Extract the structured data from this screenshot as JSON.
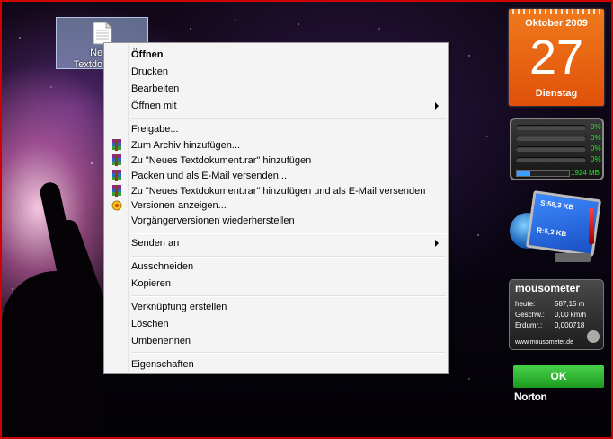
{
  "desktop": {
    "icon_label": "Neues Textdokument"
  },
  "context_menu": {
    "items": [
      {
        "label": "Öffnen",
        "bold": true,
        "submenu": false,
        "icon": null
      },
      {
        "label": "Drucken",
        "submenu": false,
        "icon": null
      },
      {
        "label": "Bearbeiten",
        "submenu": false,
        "icon": null
      },
      {
        "label": "Öffnen mit",
        "submenu": true,
        "icon": null
      },
      {
        "label": "Freigabe...",
        "submenu": false,
        "icon": null
      },
      {
        "label": "Zum Archiv hinzufügen...",
        "submenu": false,
        "icon": "winrar-icon"
      },
      {
        "label": "Zu \"Neues Textdokument.rar\" hinzufügen",
        "submenu": false,
        "icon": "winrar-icon"
      },
      {
        "label": "Packen und als E-Mail versenden...",
        "submenu": false,
        "icon": "winrar-icon"
      },
      {
        "label": "Zu \"Neues Textdokument.rar\" hinzufügen und als E-Mail versenden",
        "submenu": false,
        "icon": "winrar-icon"
      },
      {
        "label": "Versionen anzeigen...",
        "submenu": false,
        "icon": "versions-icon"
      },
      {
        "label": "Vorgängerversionen wiederherstellen",
        "submenu": false,
        "icon": null
      },
      {
        "label": "Senden an",
        "submenu": true,
        "icon": null
      },
      {
        "label": "Ausschneiden",
        "submenu": false,
        "icon": null
      },
      {
        "label": "Kopieren",
        "submenu": false,
        "icon": null
      },
      {
        "label": "Verknüpfung erstellen",
        "submenu": false,
        "icon": null
      },
      {
        "label": "Löschen",
        "submenu": false,
        "icon": null
      },
      {
        "label": "Umbenennen",
        "submenu": false,
        "icon": null
      },
      {
        "label": "Eigenschaften",
        "submenu": false,
        "icon": null
      }
    ]
  },
  "calendar": {
    "month_year": "Oktober 2009",
    "day": "27",
    "weekday": "Dienstag"
  },
  "cpu_meter": {
    "cores": [
      "0%",
      "0%",
      "0%",
      "0%"
    ],
    "memory": "1924 MB",
    "memory_fill_fraction": 0.25
  },
  "network_meter": {
    "send": "S:58,3 KB",
    "receive": "R:5,3 KB"
  },
  "mousometer": {
    "title": "mousometer",
    "rows": [
      {
        "label": "heute:",
        "value": "587,15 m"
      },
      {
        "label": "Geschw.:",
        "value": "0,00 km/h"
      },
      {
        "label": "Erdumr.:",
        "value": "0,000718"
      }
    ],
    "url": "www.mousometer.de"
  },
  "norton": {
    "status": "OK",
    "brand": "Norton"
  },
  "colors": {
    "calendar_orange": "#e0510a",
    "norton_green": "#1c9a1e",
    "frame_red": "#d00000"
  }
}
